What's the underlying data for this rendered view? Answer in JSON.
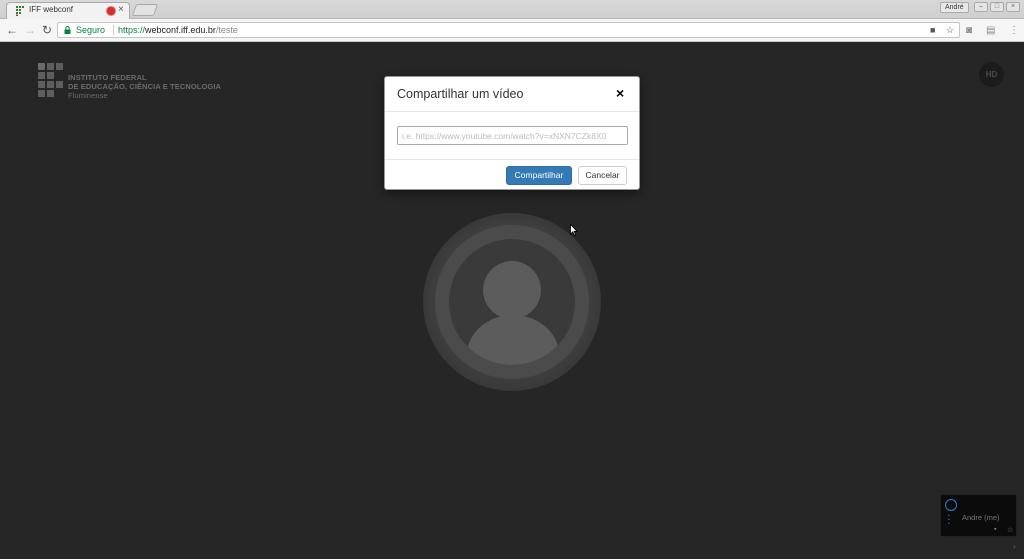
{
  "browser": {
    "tab_title": "IFF webconf",
    "tab_close": "×",
    "profile_name": "André",
    "security_label": "Seguro",
    "url_protocol": "https://",
    "url_host": "webconf.iff.edu.br",
    "url_path": "/teste",
    "recording_color": "#d32f2f"
  },
  "page": {
    "logo": {
      "line1": "INSTITUTO FEDERAL",
      "line2": "DE EDUCAÇÃO, CIÊNCIA E TECNOLOGIA",
      "line3": "Fluminense"
    },
    "hd_label": "HD",
    "local_video": {
      "name": "Andre (me)"
    }
  },
  "modal": {
    "title": "Compartilhar um vídeo",
    "close_glyph": "×",
    "input_placeholder": "i.e. https://www.youtube.com/watch?v=xNXN7CZk8X0",
    "input_value": "",
    "share_button": "Compartilhar",
    "cancel_button": "Cancelar",
    "primary_color": "#337ab7"
  }
}
